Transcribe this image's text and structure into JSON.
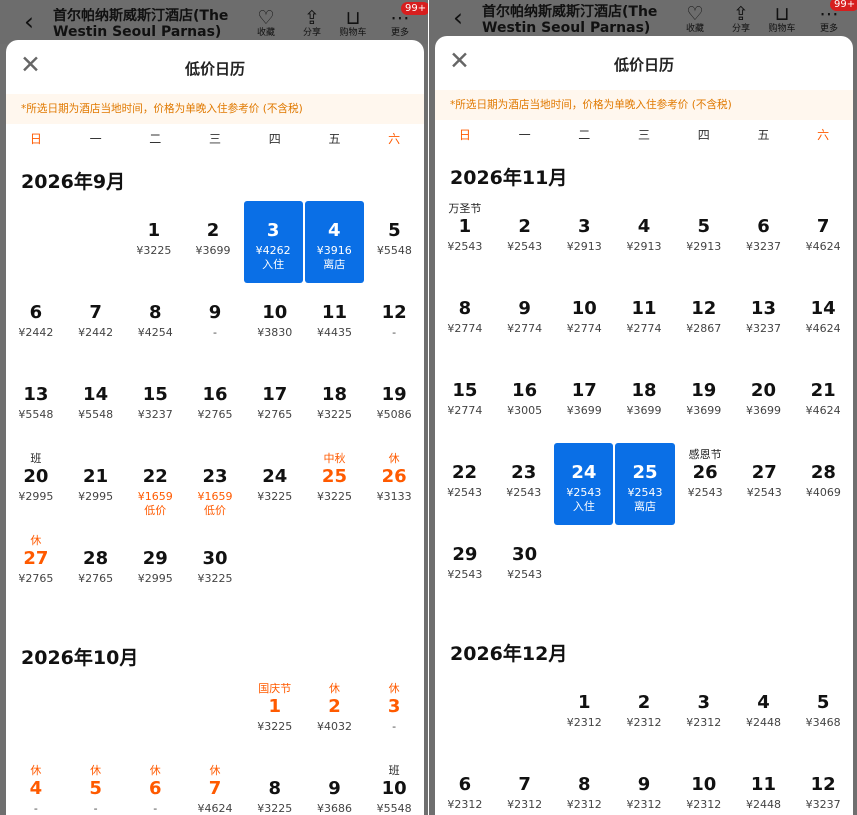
{
  "topbar": {
    "hotel_name": "首尔帕纳斯威斯汀酒店(The Westin Seoul Parnas)",
    "collect_label": "收藏",
    "share_label": "分享",
    "cart_label": "购物车",
    "more_label": "更多",
    "badge": "99+"
  },
  "sheet": {
    "title": "低价日历",
    "notice": "*所选日期为酒店当地时间，价格为单晚入住参考价 (不含税)"
  },
  "weekdays": [
    "日",
    "一",
    "二",
    "三",
    "四",
    "五",
    "六"
  ],
  "left_months": [
    {
      "title": "2026年9月",
      "offset": 2,
      "days": [
        {
          "d": "1",
          "p": "¥3225"
        },
        {
          "d": "2",
          "p": "¥3699"
        },
        {
          "d": "3",
          "p": "¥4262",
          "s": "入住",
          "sel": true
        },
        {
          "d": "4",
          "p": "¥3916",
          "s": "离店",
          "sel": true
        },
        {
          "d": "5",
          "p": "¥5548"
        },
        {
          "d": "6",
          "p": "¥2442"
        },
        {
          "d": "7",
          "p": "¥2442"
        },
        {
          "d": "8",
          "p": "¥4254"
        },
        {
          "d": "9",
          "p": "-"
        },
        {
          "d": "10",
          "p": "¥3830"
        },
        {
          "d": "11",
          "p": "¥4435"
        },
        {
          "d": "12",
          "p": "-"
        },
        {
          "d": "13",
          "p": "¥5548"
        },
        {
          "d": "14",
          "p": "¥5548"
        },
        {
          "d": "15",
          "p": "¥3237"
        },
        {
          "d": "16",
          "p": "¥2765"
        },
        {
          "d": "17",
          "p": "¥2765"
        },
        {
          "d": "18",
          "p": "¥3225"
        },
        {
          "d": "19",
          "p": "¥5086"
        },
        {
          "d": "20",
          "p": "¥2995",
          "t": "班",
          "tplain": true
        },
        {
          "d": "21",
          "p": "¥2995"
        },
        {
          "d": "22",
          "p": "¥1659",
          "s": "低价",
          "low": true
        },
        {
          "d": "23",
          "p": "¥1659",
          "s": "低价",
          "low": true
        },
        {
          "d": "24",
          "p": "¥3225"
        },
        {
          "d": "25",
          "p": "¥3225",
          "t": "中秋",
          "hol": true
        },
        {
          "d": "26",
          "p": "¥3133",
          "t": "休",
          "hol": true
        },
        {
          "d": "27",
          "p": "¥2765",
          "t": "休",
          "hol": true
        },
        {
          "d": "28",
          "p": "¥2765"
        },
        {
          "d": "29",
          "p": "¥2995"
        },
        {
          "d": "30",
          "p": "¥3225"
        }
      ]
    },
    {
      "title": "2026年10月",
      "offset": 4,
      "days": [
        {
          "d": "1",
          "p": "¥3225",
          "t": "国庆节",
          "hol": true
        },
        {
          "d": "2",
          "p": "¥4032",
          "t": "休",
          "hol": true
        },
        {
          "d": "3",
          "p": "-",
          "t": "休",
          "hol": true
        },
        {
          "d": "4",
          "p": "-",
          "t": "休",
          "hol": true
        },
        {
          "d": "5",
          "p": "-",
          "t": "休",
          "hol": true
        },
        {
          "d": "6",
          "p": "-",
          "t": "休",
          "hol": true
        },
        {
          "d": "7",
          "p": "¥4624",
          "t": "休",
          "hol": true
        },
        {
          "d": "8",
          "p": "¥3225"
        },
        {
          "d": "9",
          "p": "¥3686"
        },
        {
          "d": "10",
          "p": "¥5548",
          "t": "班",
          "tplain": true
        }
      ]
    }
  ],
  "right_months": [
    {
      "title": "2026年11月",
      "offset": 0,
      "days": [
        {
          "d": "1",
          "p": "¥2543",
          "t": "万圣节",
          "tplain": true
        },
        {
          "d": "2",
          "p": "¥2543"
        },
        {
          "d": "3",
          "p": "¥2913"
        },
        {
          "d": "4",
          "p": "¥2913"
        },
        {
          "d": "5",
          "p": "¥2913"
        },
        {
          "d": "6",
          "p": "¥3237"
        },
        {
          "d": "7",
          "p": "¥4624"
        },
        {
          "d": "8",
          "p": "¥2774"
        },
        {
          "d": "9",
          "p": "¥2774"
        },
        {
          "d": "10",
          "p": "¥2774"
        },
        {
          "d": "11",
          "p": "¥2774"
        },
        {
          "d": "12",
          "p": "¥2867"
        },
        {
          "d": "13",
          "p": "¥3237"
        },
        {
          "d": "14",
          "p": "¥4624"
        },
        {
          "d": "15",
          "p": "¥2774"
        },
        {
          "d": "16",
          "p": "¥3005"
        },
        {
          "d": "17",
          "p": "¥3699"
        },
        {
          "d": "18",
          "p": "¥3699"
        },
        {
          "d": "19",
          "p": "¥3699"
        },
        {
          "d": "20",
          "p": "¥3699"
        },
        {
          "d": "21",
          "p": "¥4624"
        },
        {
          "d": "22",
          "p": "¥2543"
        },
        {
          "d": "23",
          "p": "¥2543"
        },
        {
          "d": "24",
          "p": "¥2543",
          "s": "入住",
          "sel": true
        },
        {
          "d": "25",
          "p": "¥2543",
          "s": "离店",
          "sel": true
        },
        {
          "d": "26",
          "p": "¥2543",
          "t": "感恩节",
          "tplain": true
        },
        {
          "d": "27",
          "p": "¥2543"
        },
        {
          "d": "28",
          "p": "¥4069"
        },
        {
          "d": "29",
          "p": "¥2543"
        },
        {
          "d": "30",
          "p": "¥2543"
        }
      ]
    },
    {
      "title": "2026年12月",
      "offset": 2,
      "days": [
        {
          "d": "1",
          "p": "¥2312"
        },
        {
          "d": "2",
          "p": "¥2312"
        },
        {
          "d": "3",
          "p": "¥2312"
        },
        {
          "d": "4",
          "p": "¥2448"
        },
        {
          "d": "5",
          "p": "¥3468"
        },
        {
          "d": "6",
          "p": "¥2312"
        },
        {
          "d": "7",
          "p": "¥2312"
        },
        {
          "d": "8",
          "p": "¥2312"
        },
        {
          "d": "9",
          "p": "¥2312"
        },
        {
          "d": "10",
          "p": "¥2312"
        },
        {
          "d": "11",
          "p": "¥2448"
        },
        {
          "d": "12",
          "p": "¥3237"
        }
      ]
    }
  ]
}
